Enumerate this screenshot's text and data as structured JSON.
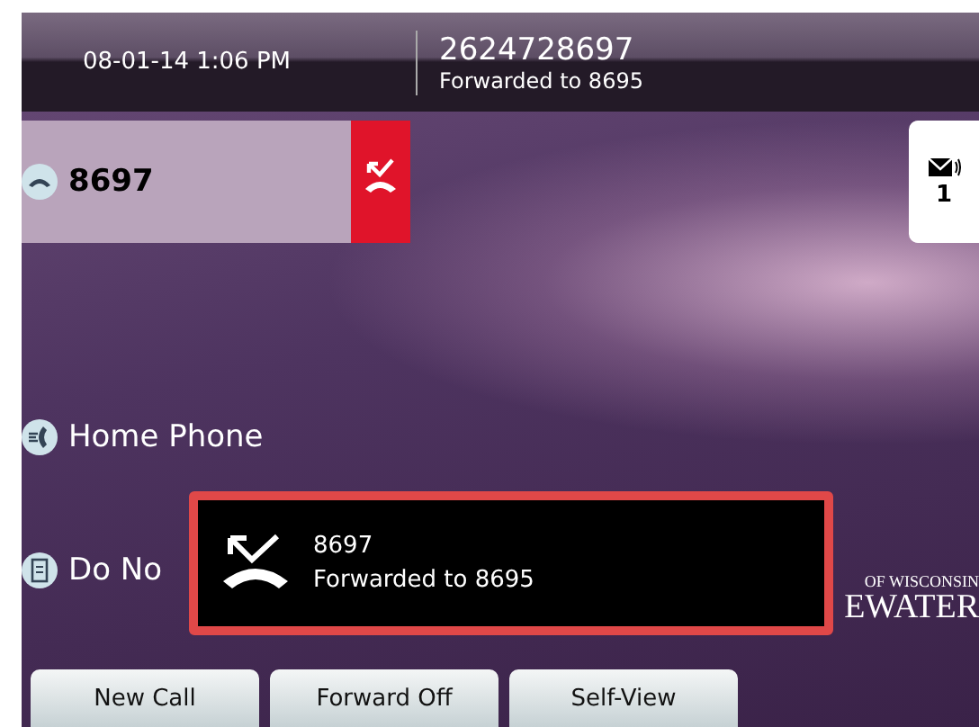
{
  "status_bar": {
    "datetime": "08-01-14 1:06 PM",
    "caller_number": "2624728697",
    "caller_status": "Forwarded to 8695"
  },
  "line": {
    "label": "8697"
  },
  "messages": {
    "count": "1"
  },
  "features": [
    {
      "kind": "home",
      "label": "Home Phone"
    },
    {
      "kind": "dnd",
      "label": "Do No"
    }
  ],
  "logo": {
    "line_1": "OF WISCONSIN",
    "line_2": "EWATER"
  },
  "popup": {
    "title": "8697",
    "message": "Forwarded to 8695"
  },
  "softkeys": [
    "New Call",
    "Forward Off",
    "Self-View"
  ]
}
